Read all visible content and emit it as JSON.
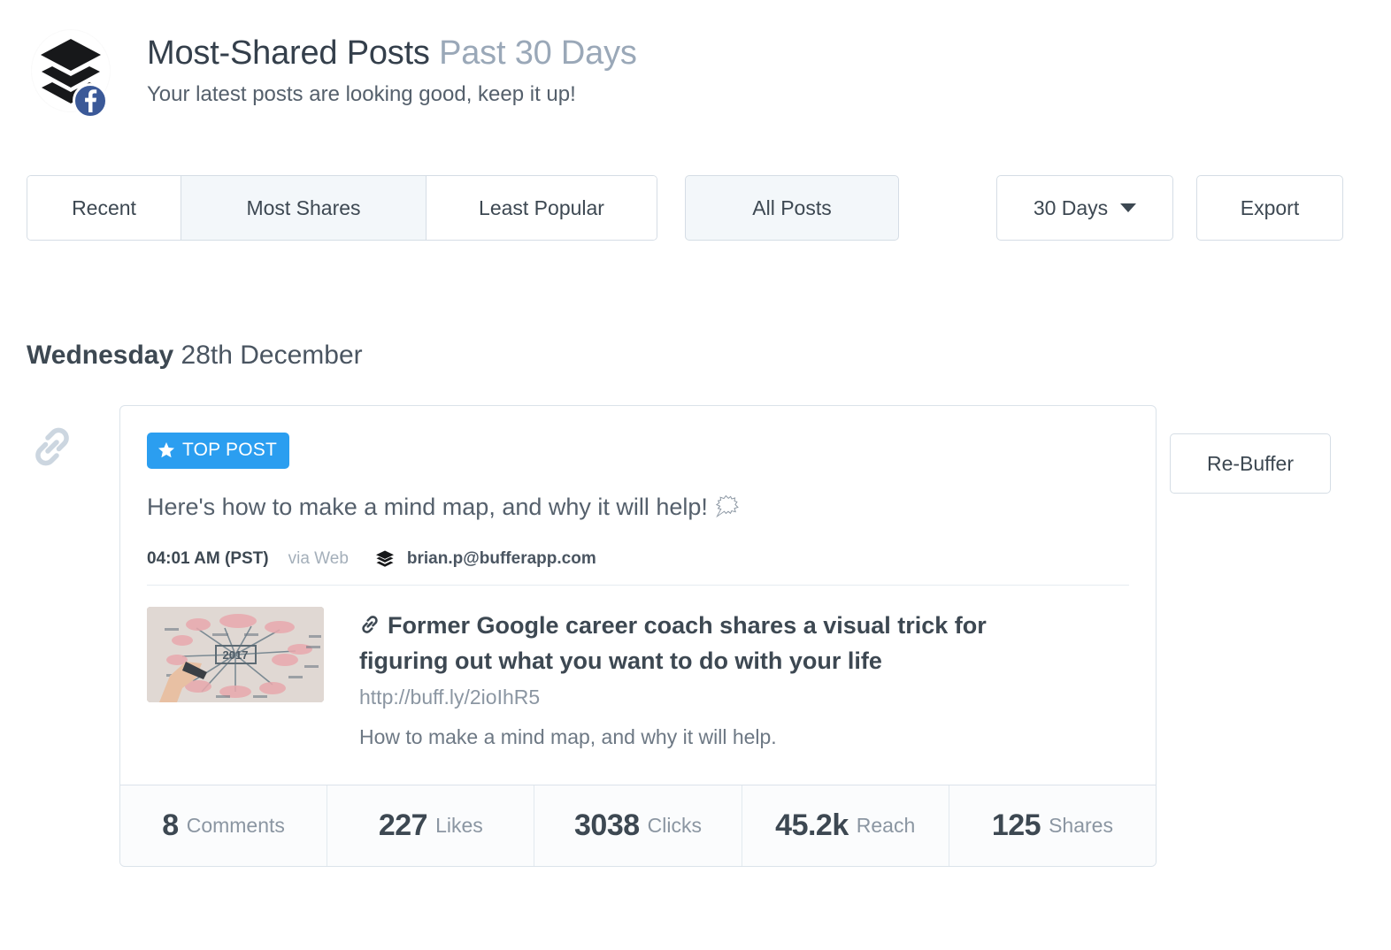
{
  "header": {
    "title_main": "Most-Shared Posts",
    "title_muted": "Past 30 Days",
    "subtitle": "Your latest posts are looking good, keep it up!",
    "avatar_icon": "buffer-stack-logo",
    "network_badge_icon": "facebook-icon"
  },
  "controls": {
    "segments": [
      {
        "label": "Recent",
        "active": false
      },
      {
        "label": "Most Shares",
        "active": true
      },
      {
        "label": "Least Popular",
        "active": false
      }
    ],
    "all_posts_label": "All Posts",
    "all_posts_active": true,
    "date_range_label": "30 Days",
    "date_range_caret_icon": "chevron-down-icon",
    "export_label": "Export"
  },
  "day_group": {
    "weekday": "Wednesday",
    "date": "28th December",
    "gutter_icon": "link-chain-icon"
  },
  "post": {
    "badge_label": "TOP POST",
    "badge_icon": "star-icon",
    "badge_color": "#2b9ef0",
    "text": "Here's how to make a mind map, and why it will help!",
    "text_emoji": "🗯",
    "meta": {
      "time": "04:01 AM (PST)",
      "via": "via Web",
      "account_icon": "buffer-stack-icon",
      "account": "brian.p@bufferapp.com"
    },
    "link": {
      "thumbnail_alt": "whiteboard mind map photo with 2017 in the center",
      "title_icon": "link-chain-icon",
      "title": "Former Google career coach shares a visual trick for figuring out what you want to do with your life",
      "url": "http://buff.ly/2ioIhR5",
      "description": "How to make a mind map, and why it will help."
    },
    "stats": [
      {
        "value": "8",
        "label": "Comments"
      },
      {
        "value": "227",
        "label": "Likes"
      },
      {
        "value": "3038",
        "label": "Clicks"
      },
      {
        "value": "45.2k",
        "label": "Reach"
      },
      {
        "value": "125",
        "label": "Shares"
      }
    ],
    "rebuffer_label": "Re-Buffer"
  }
}
